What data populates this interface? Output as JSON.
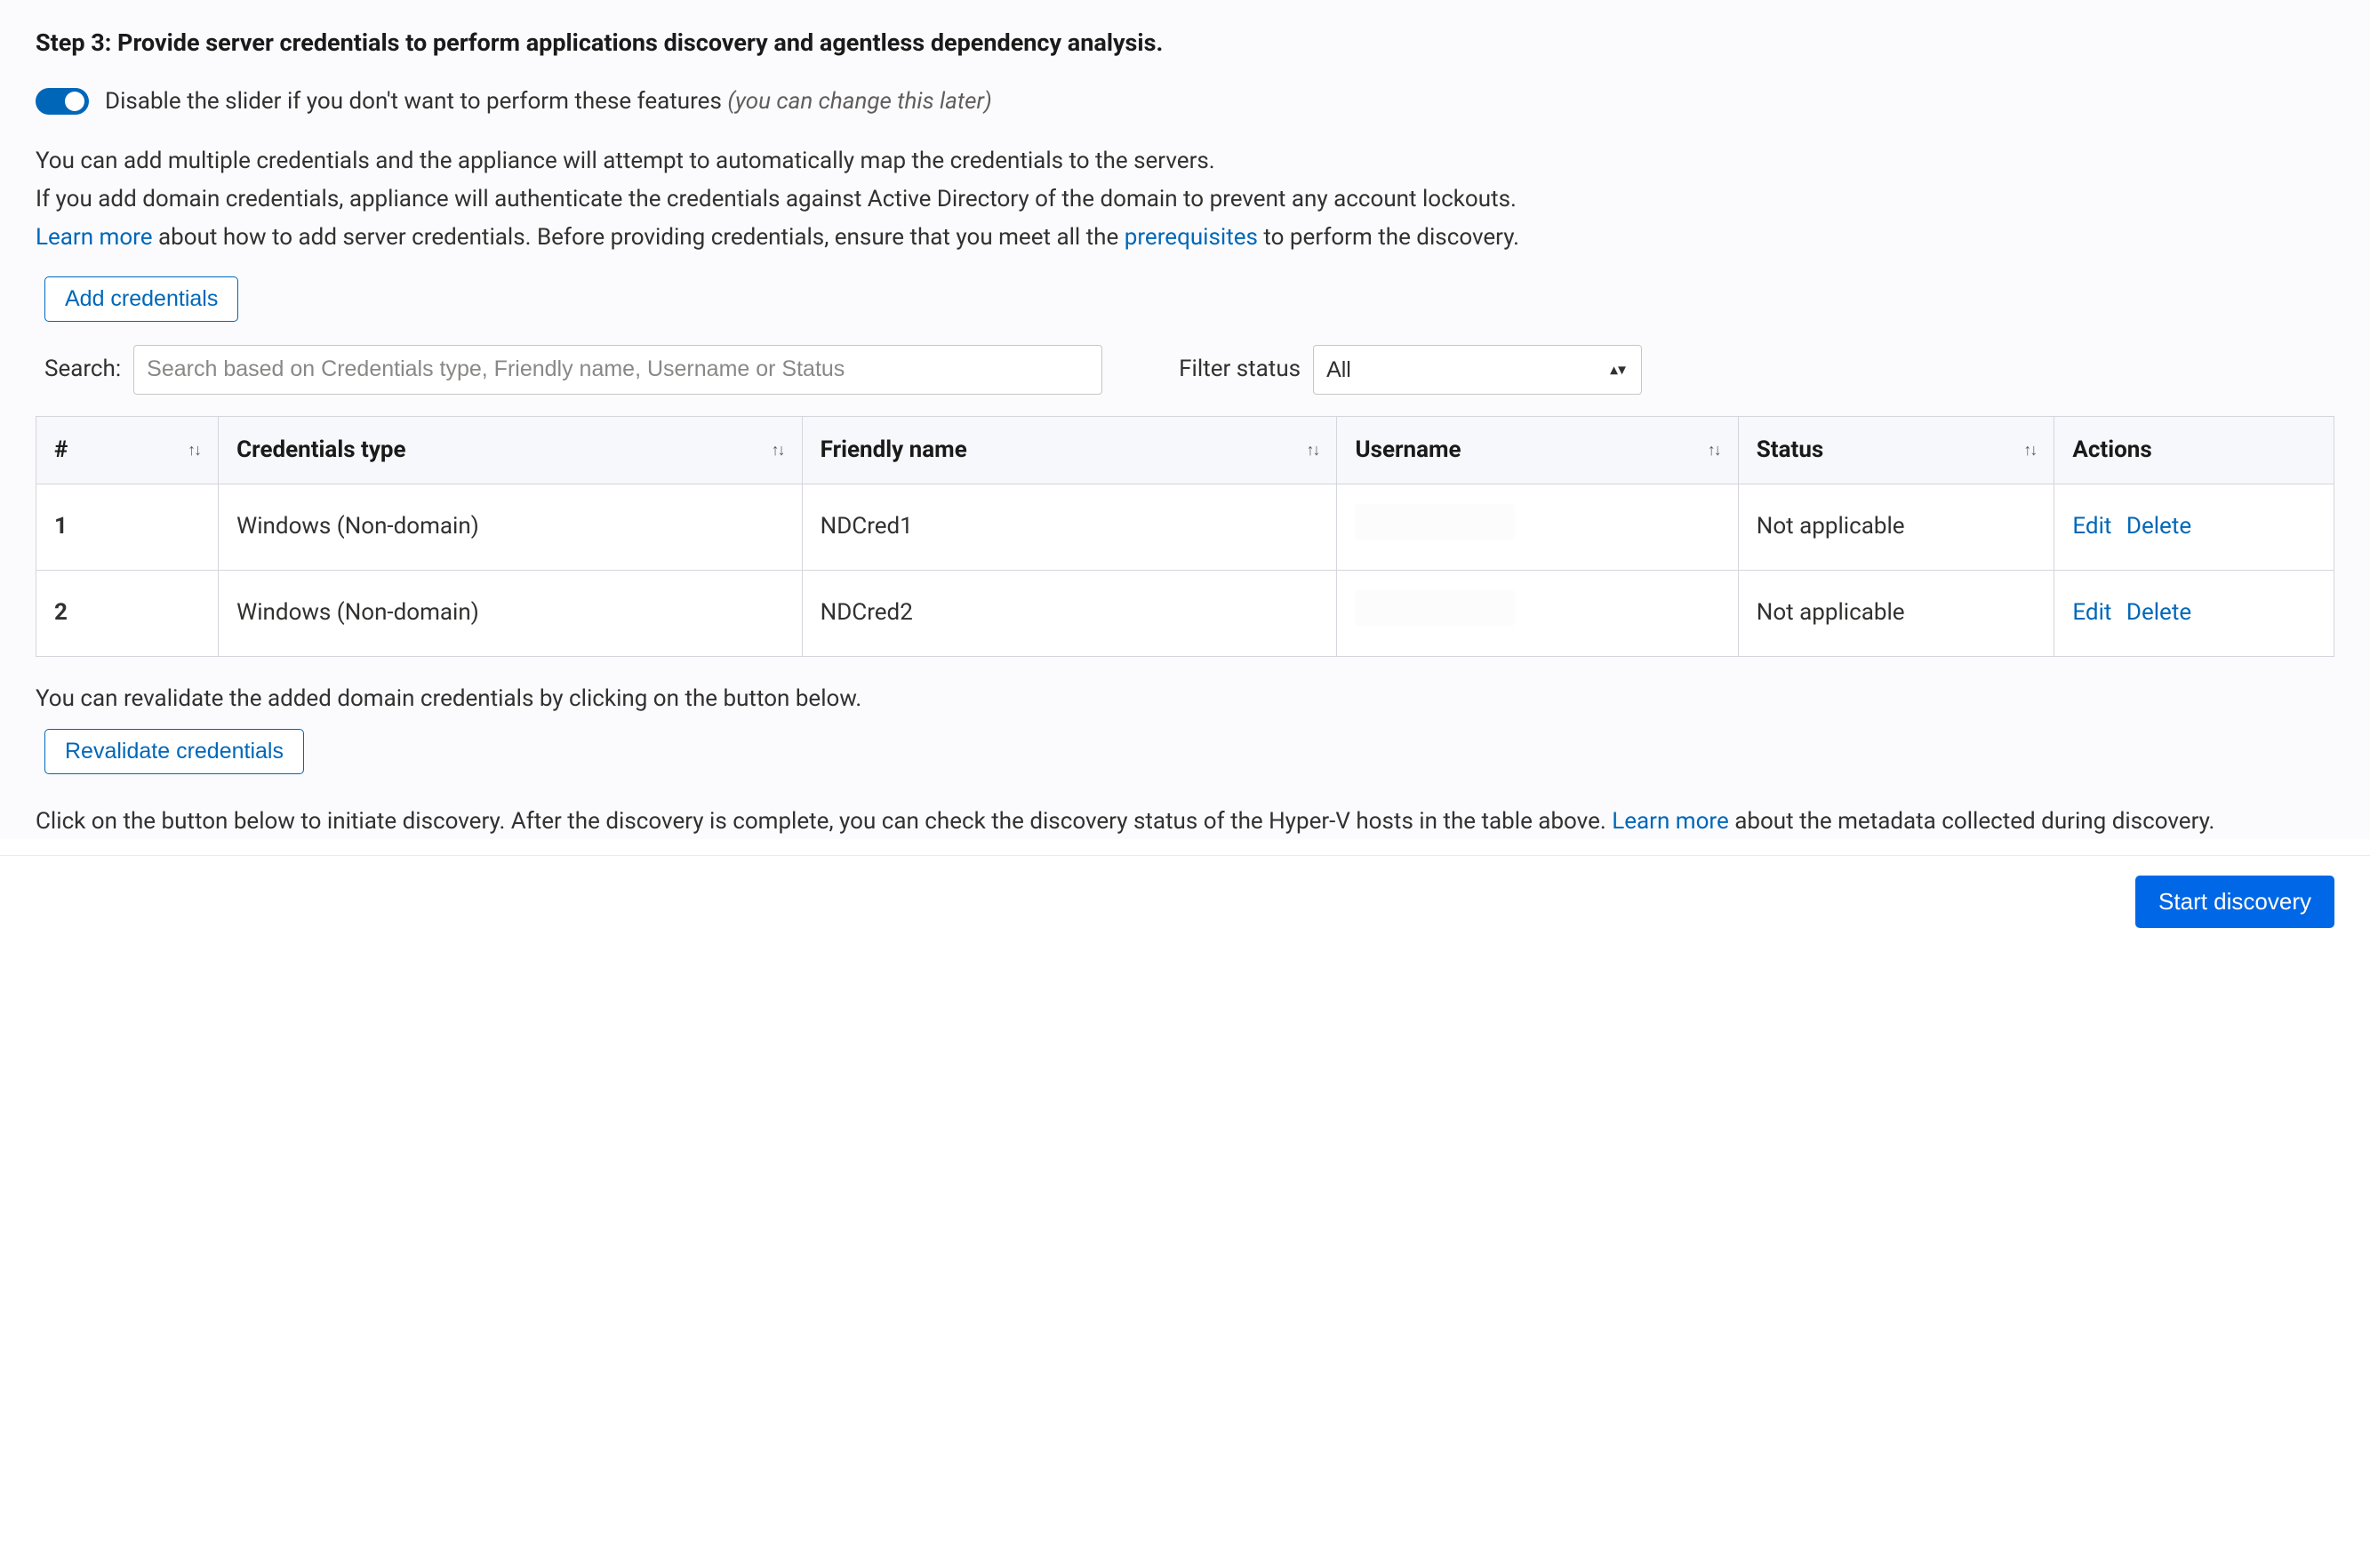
{
  "step": {
    "title": "Step 3: Provide server credentials to perform applications discovery and agentless dependency analysis."
  },
  "toggle": {
    "label_plain": "Disable the slider if you don't want to perform these features ",
    "label_italic": "(you can change this later)"
  },
  "desc": {
    "line1": "You can add multiple credentials and the appliance will attempt to automatically map the credentials to the servers.",
    "line2": "If you add domain credentials, appliance will authenticate the credentials against Active Directory of the domain to prevent any account lockouts.",
    "line3a": "Learn more",
    "line3b": " about how to add server credentials. Before providing credentials, ensure that you meet all the ",
    "line3c": "prerequisites",
    "line3d": " to perform the discovery."
  },
  "buttons": {
    "add_credentials": "Add credentials",
    "revalidate": "Revalidate credentials",
    "start_discovery": "Start discovery"
  },
  "search": {
    "label": "Search:",
    "placeholder": "Search based on Credentials type, Friendly name, Username or Status"
  },
  "filter": {
    "label": "Filter status",
    "value": "All"
  },
  "table": {
    "headers": {
      "num": "#",
      "type": "Credentials type",
      "name": "Friendly name",
      "user": "Username",
      "status": "Status",
      "actions": "Actions"
    },
    "rows": [
      {
        "num": "1",
        "type": "Windows (Non-domain)",
        "name": "NDCred1",
        "user": "",
        "status": "Not applicable"
      },
      {
        "num": "2",
        "type": "Windows (Non-domain)",
        "name": "NDCred2",
        "user": "",
        "status": "Not applicable"
      }
    ],
    "actions": {
      "edit": "Edit",
      "delete": "Delete"
    }
  },
  "revalidate_desc": "You can revalidate the added domain credentials by clicking on the button below.",
  "discover_desc": {
    "a": "Click on the button below to initiate discovery. After the discovery is complete, you can check the discovery status of the Hyper-V hosts in the table above. ",
    "link": "Learn more",
    "b": " about the metadata collected during discovery."
  }
}
